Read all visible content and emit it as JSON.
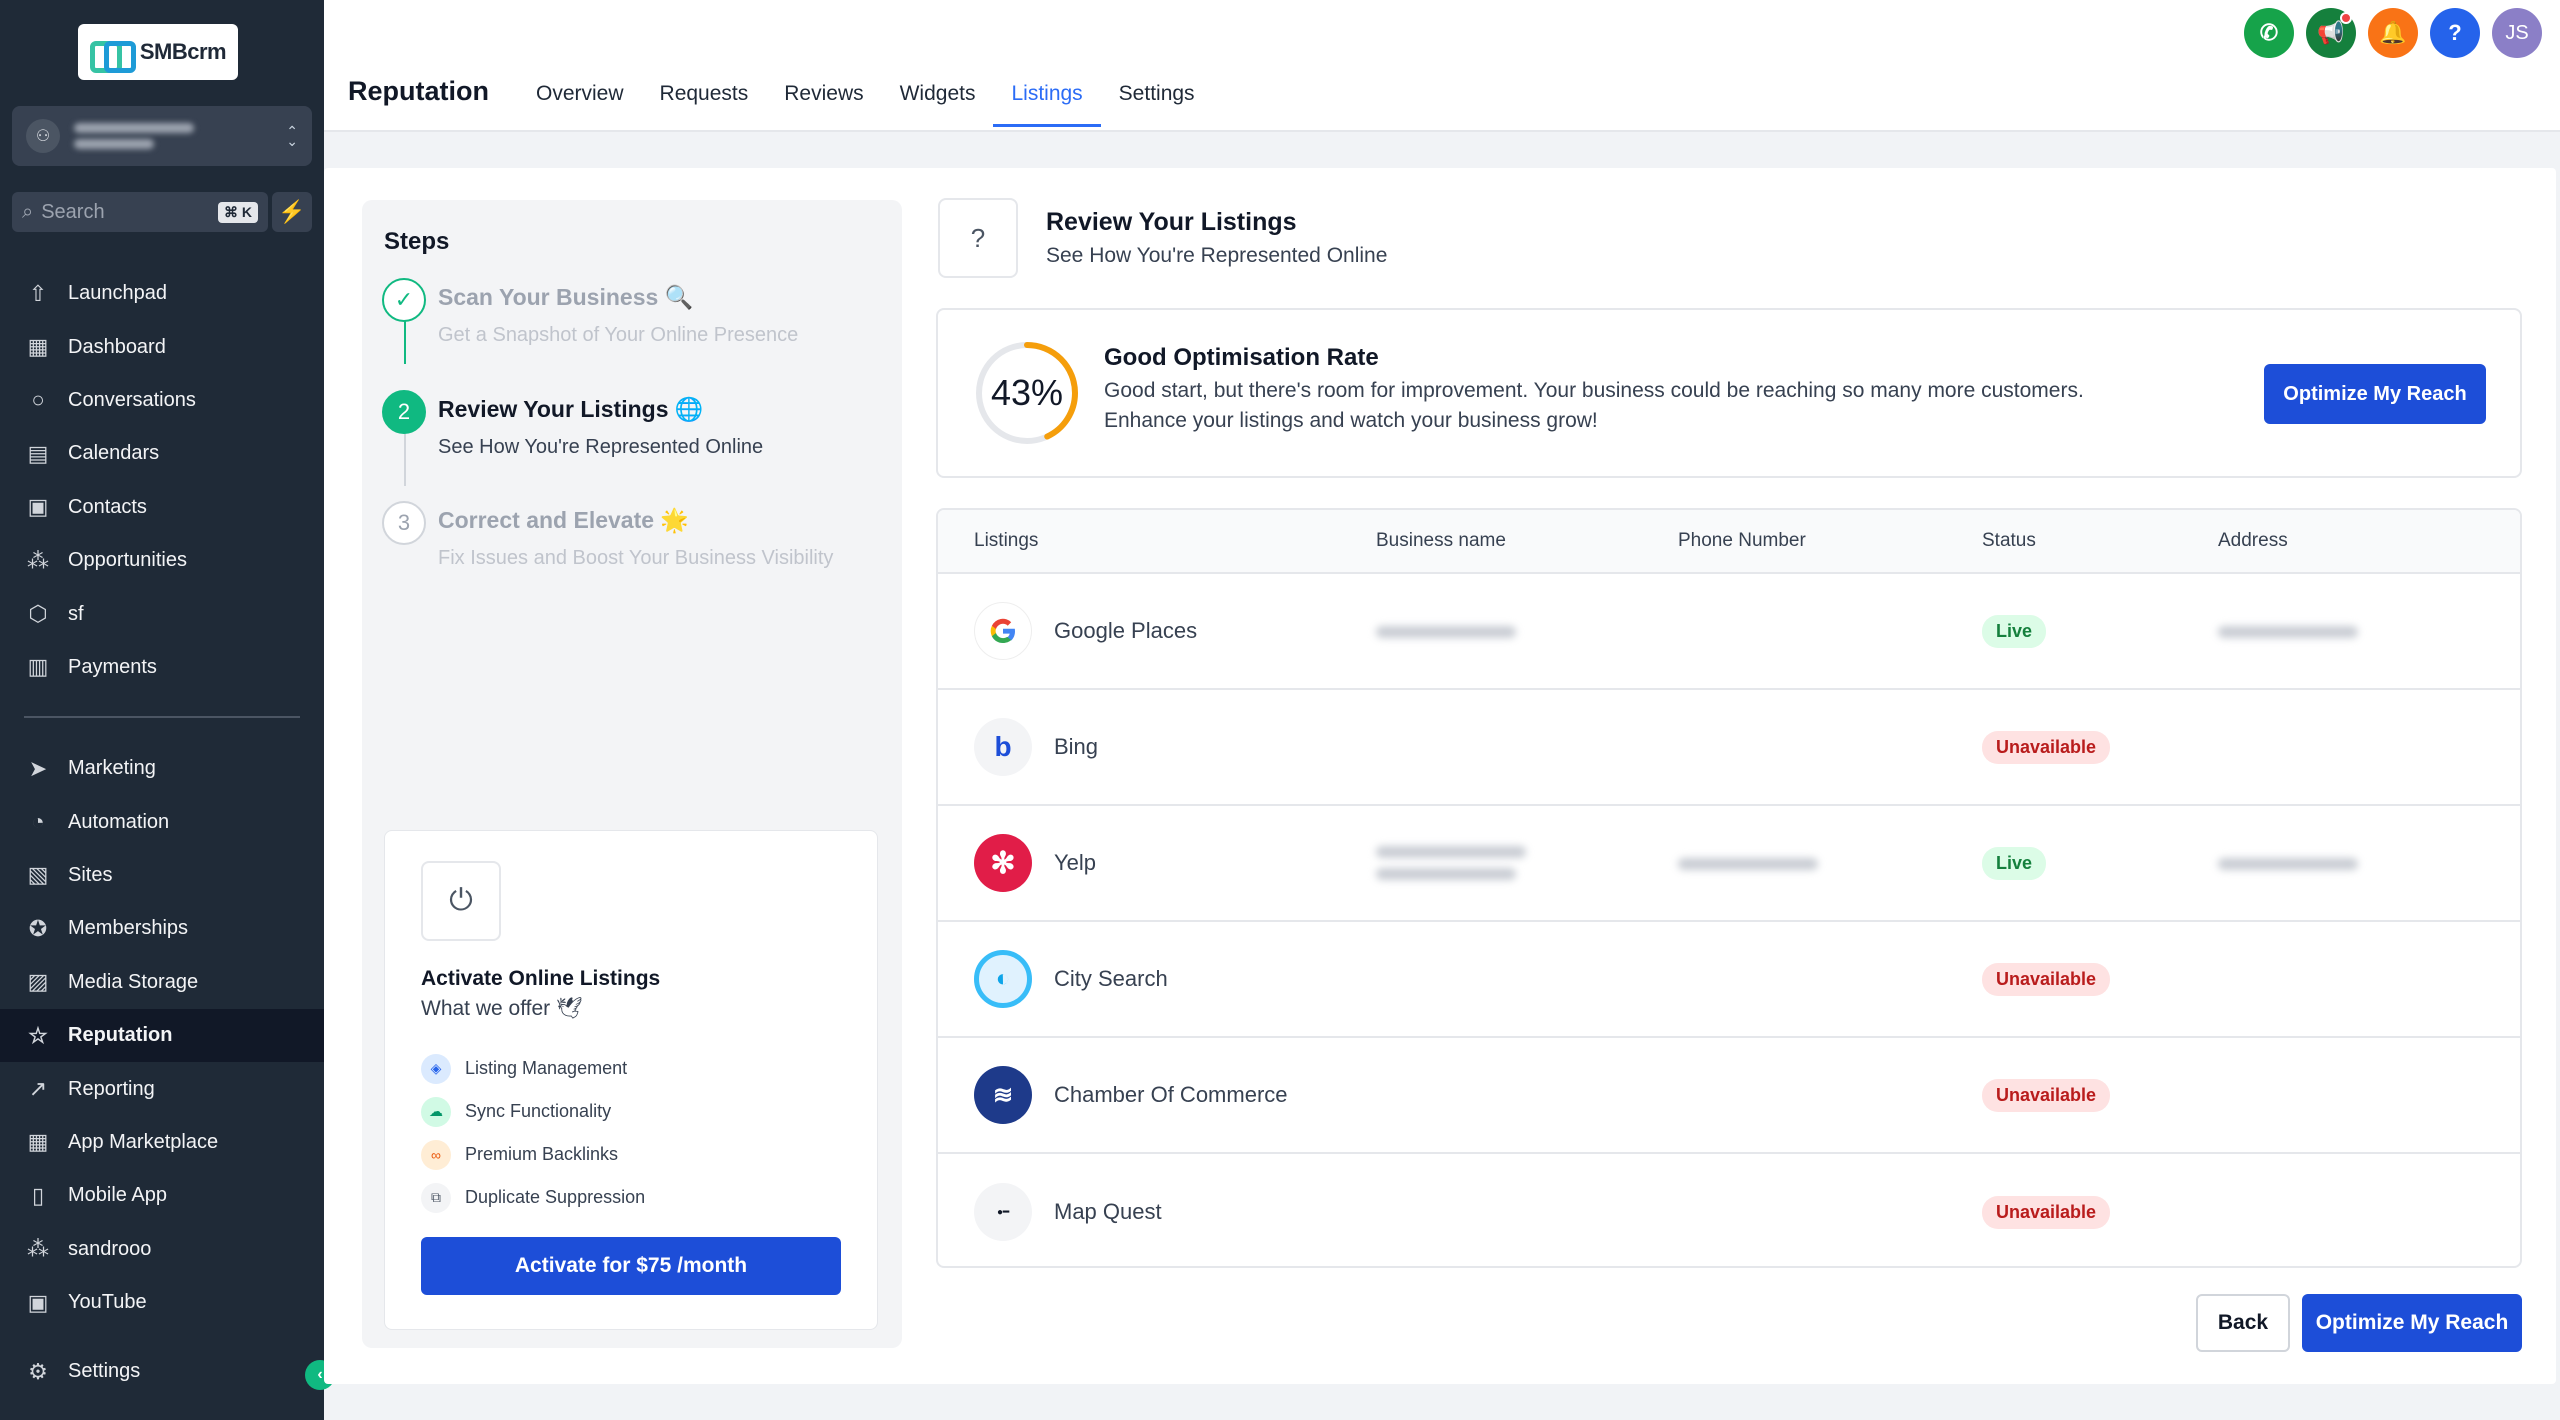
{
  "app": {
    "logo_text": "SMBcrm"
  },
  "search": {
    "placeholder": "Search",
    "shortcut": "⌘ K"
  },
  "sidebar": {
    "items": [
      {
        "label": "Launchpad",
        "icon": "rocket-icon"
      },
      {
        "label": "Dashboard",
        "icon": "grid-icon"
      },
      {
        "label": "Conversations",
        "icon": "chat-icon"
      },
      {
        "label": "Calendars",
        "icon": "calendar-icon"
      },
      {
        "label": "Contacts",
        "icon": "contacts-icon"
      },
      {
        "label": "Opportunities",
        "icon": "network-icon"
      },
      {
        "label": "sf",
        "icon": "cube-icon"
      },
      {
        "label": "Payments",
        "icon": "payments-icon"
      }
    ],
    "items2": [
      {
        "label": "Marketing",
        "icon": "send-icon"
      },
      {
        "label": "Automation",
        "icon": "automation-icon"
      },
      {
        "label": "Sites",
        "icon": "sites-icon"
      },
      {
        "label": "Memberships",
        "icon": "award-icon"
      },
      {
        "label": "Media Storage",
        "icon": "image-icon"
      },
      {
        "label": "Reputation",
        "icon": "star-icon",
        "active": true
      },
      {
        "label": "Reporting",
        "icon": "trend-icon"
      },
      {
        "label": "App Marketplace",
        "icon": "apps-icon"
      },
      {
        "label": "Mobile App",
        "icon": "phone-icon"
      },
      {
        "label": "sandrooo",
        "icon": "network-icon"
      },
      {
        "label": "YouTube",
        "icon": "youtube-icon"
      }
    ],
    "settings": "Settings"
  },
  "header": {
    "title": "Reputation",
    "tabs": [
      "Overview",
      "Requests",
      "Reviews",
      "Widgets",
      "Listings",
      "Settings"
    ],
    "active_tab": "Listings",
    "user_initials": "JS"
  },
  "steps": {
    "title": "Steps",
    "items": [
      {
        "title": "Scan Your Business 🔍",
        "subtitle": "Get a Snapshot of Your Online Presence",
        "state": "done"
      },
      {
        "number": "2",
        "title": "Review Your Listings 🌐",
        "subtitle": "See How You're Represented Online",
        "state": "current"
      },
      {
        "number": "3",
        "title": "Correct and Elevate 🌟",
        "subtitle": "Fix Issues and Boost Your Business Visibility",
        "state": "pending"
      }
    ]
  },
  "offer": {
    "title": "Activate Online Listings",
    "subtitle": "What we offer 🕊",
    "features": [
      "Listing Management",
      "Sync Functionality",
      "Premium Backlinks",
      "Duplicate Suppression"
    ],
    "button": "Activate for $75 /month"
  },
  "review": {
    "title": "Review Your Listings",
    "subtitle": "See How You're Represented Online"
  },
  "optimisation": {
    "percent_label": "43%",
    "percent": 43,
    "title": "Good Optimisation Rate",
    "description": "Good start, but there's room for improvement. Your business could be reaching so many more customers. Enhance your listings and watch your business grow!",
    "button": "Optimize My Reach"
  },
  "table": {
    "headers": [
      "Listings",
      "Business name",
      "Phone Number",
      "Status",
      "Address"
    ],
    "rows": [
      {
        "name": "Google Places",
        "status": "Live"
      },
      {
        "name": "Bing",
        "status": "Unavailable"
      },
      {
        "name": "Yelp",
        "status": "Live"
      },
      {
        "name": "City Search",
        "status": "Unavailable"
      },
      {
        "name": "Chamber Of Commerce",
        "status": "Unavailable"
      },
      {
        "name": "Map Quest",
        "status": "Unavailable"
      }
    ]
  },
  "footer": {
    "back": "Back",
    "optimize": "Optimize My Reach"
  },
  "colors": {
    "primary": "#1d4ed8",
    "success": "#10b981",
    "sidebar": "#1f2a37",
    "gauge": "#f59e0b"
  }
}
